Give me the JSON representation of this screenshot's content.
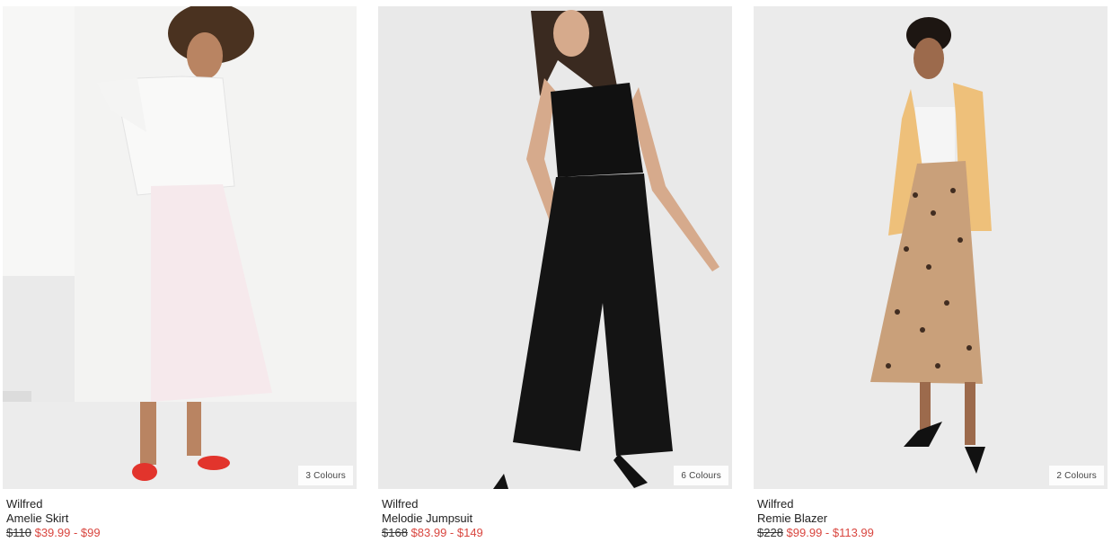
{
  "products": [
    {
      "brand": "Wilfred",
      "name": "Amelie Skirt",
      "original_price": "$110",
      "sale_price": "$39.99 - $99",
      "colours": "3 Colours"
    },
    {
      "brand": "Wilfred",
      "name": "Melodie Jumpsuit",
      "original_price": "$168",
      "sale_price": "$83.99 - $149",
      "colours": "6 Colours"
    },
    {
      "brand": "Wilfred",
      "name": "Remie Blazer",
      "original_price": "$228",
      "sale_price": "$99.99 - $113.99",
      "colours": "2 Colours"
    }
  ],
  "colors": {
    "sale": "#d9463f",
    "text": "#222222",
    "photo_bg": "#eeeeee"
  }
}
